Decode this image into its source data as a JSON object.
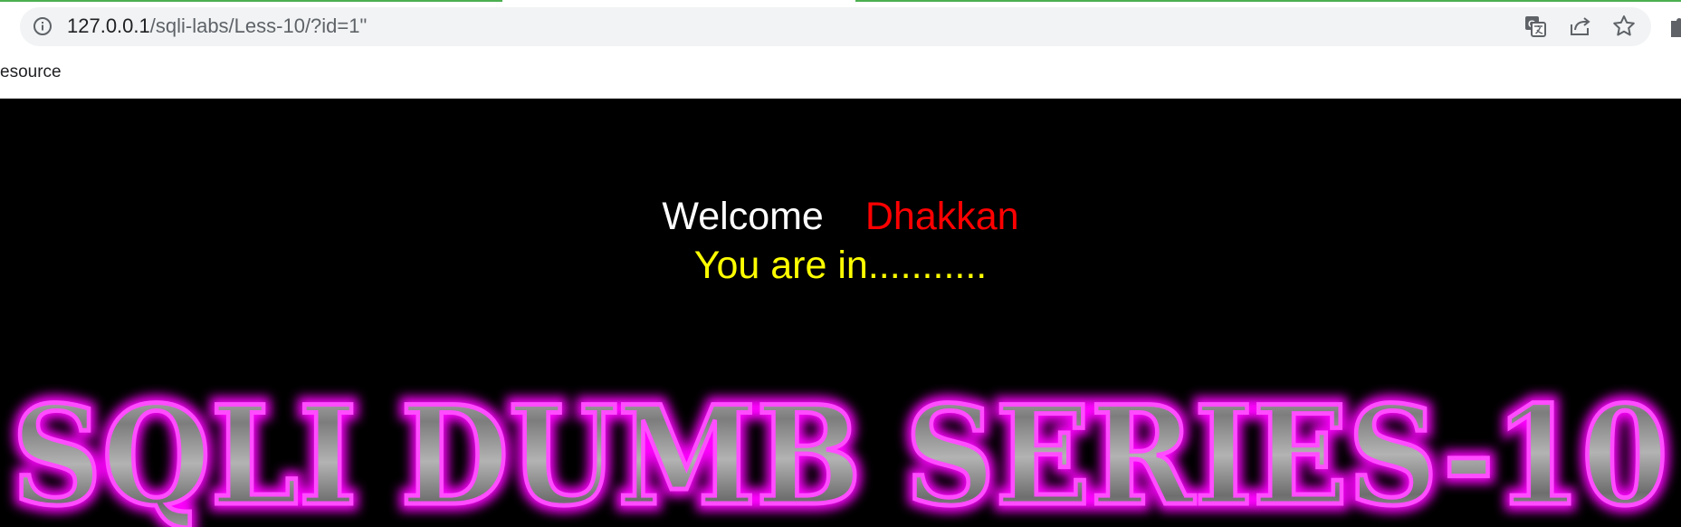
{
  "browser": {
    "url_host": "127.0.0.1",
    "url_path": "/sqli-labs/Less-10/?id=1\"",
    "icons": [
      "info-icon",
      "translate-icon",
      "share-icon",
      "star-icon",
      "extensions-icon"
    ],
    "bookmark_label": "esource"
  },
  "page": {
    "welcome_text": "Welcome",
    "user_name": "Dhakkan",
    "status_text": "You are in...........",
    "banner_text": "SQLI DUMB SERIES-10",
    "colors": {
      "background": "#000000",
      "welcome": "#ffffff",
      "user_name": "#ff0000",
      "status": "#ffff00",
      "banner_glow": "#ff00ff",
      "banner_fill": "#9a9a9a"
    }
  }
}
